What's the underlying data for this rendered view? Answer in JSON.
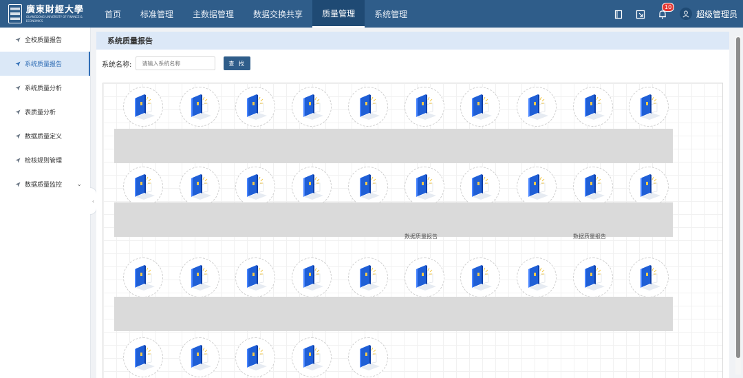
{
  "header": {
    "logo_text": "廣東財經大學",
    "logo_sub": "GUANGDONG UNIVERSITY OF FINANCE & ECONOMICS",
    "nav": [
      {
        "label": "首页",
        "active": false
      },
      {
        "label": "标准管理",
        "active": false
      },
      {
        "label": "主数据管理",
        "active": false
      },
      {
        "label": "数据交换共享",
        "active": false
      },
      {
        "label": "质量管理",
        "active": true
      },
      {
        "label": "系统管理",
        "active": false
      }
    ],
    "notification_count": "10",
    "username": "超级管理员"
  },
  "sidebar": {
    "items": [
      {
        "label": "全校质量报告",
        "active": false
      },
      {
        "label": "系统质量报告",
        "active": true
      },
      {
        "label": "系统质量分析",
        "active": false
      },
      {
        "label": "表质量分析",
        "active": false
      },
      {
        "label": "数据质量定义",
        "active": false
      },
      {
        "label": "检核规则管理",
        "active": false
      },
      {
        "label": "数据质量监控",
        "active": false,
        "expandable": true
      }
    ]
  },
  "main": {
    "panel_title": "系统质量报告",
    "search_label": "系统名称:",
    "search_placeholder": "请输入系统名称",
    "search_button": "查 找",
    "rows": [
      10,
      10,
      10,
      5
    ],
    "captions": [
      "数据质量报告",
      "数据质量报告"
    ]
  },
  "colors": {
    "header_bg": "#2f5d8a",
    "accent": "#2f6db5",
    "icon_blue": "#1f5fd6",
    "icon_yellow": "#f2c94c"
  }
}
